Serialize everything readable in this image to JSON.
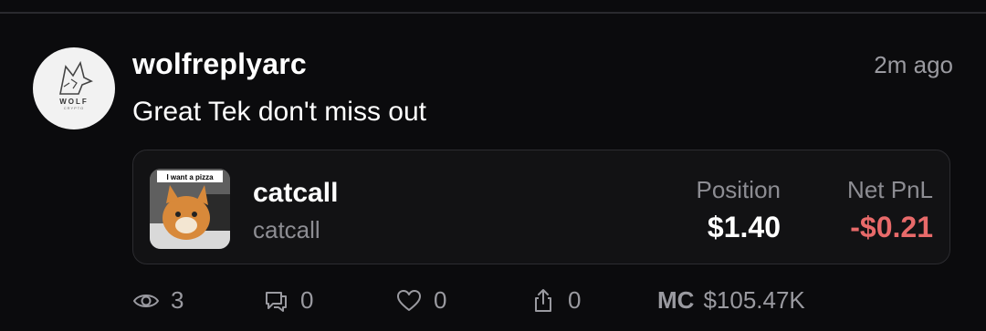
{
  "post": {
    "username": "wolfreplyarc",
    "timestamp": "2m ago",
    "message": "Great Tek don't miss out",
    "avatar": {
      "logo_text": "WOLF",
      "logo_sub": "CRYPTO"
    }
  },
  "token": {
    "image_caption": "I want a pizza",
    "name": "catcall",
    "ticker": "catcall",
    "position_label": "Position",
    "position_value": "$1.40",
    "pnl_label": "Net PnL",
    "pnl_value": "-$0.21"
  },
  "actions": {
    "views": "3",
    "comments": "0",
    "likes": "0",
    "shares": "0",
    "mc_label": "MC",
    "mc_value": "$105.47K"
  },
  "colors": {
    "background": "#0b0b0d",
    "negative": "#e86a6a",
    "muted": "#9a9aa0"
  }
}
